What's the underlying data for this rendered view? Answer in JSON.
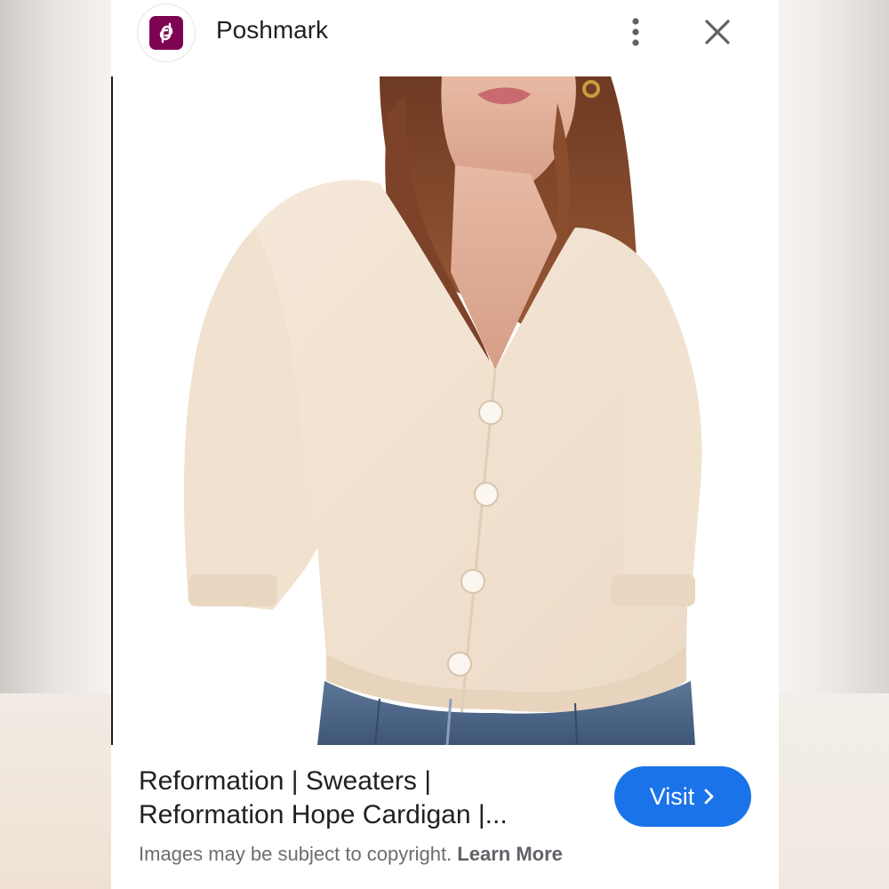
{
  "header": {
    "site_name": "Poshmark",
    "brand_color": "#7f0353",
    "logo_icon": "poshmark-logo-icon",
    "more_icon": "more-vertical-icon",
    "close_icon": "close-icon"
  },
  "image": {
    "subject": "cream short-sleeve button cardigan worn with blue jeans"
  },
  "result": {
    "title_line1": "Reformation | Sweaters |",
    "title_line2": "Reformation Hope Cardigan |...",
    "visit_label": "Visit",
    "visit_icon": "chevron-right-icon",
    "accent_color": "#1a73e8"
  },
  "footer": {
    "copyright_text": "Images may be subject to copyright.",
    "learn_more_label": "Learn More"
  }
}
